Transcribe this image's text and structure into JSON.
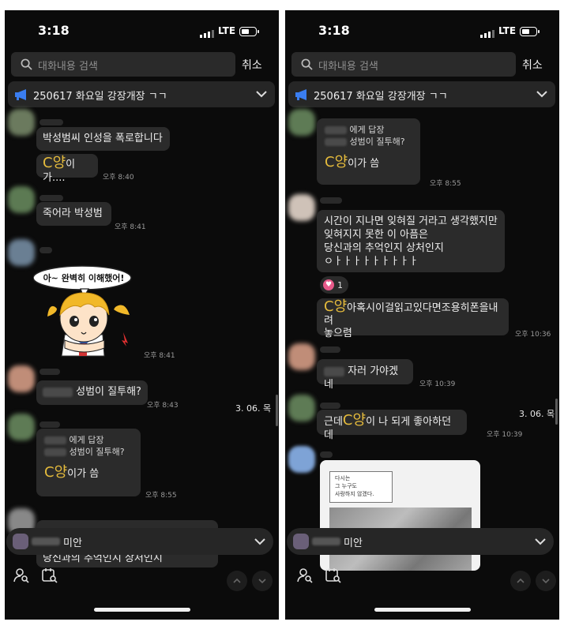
{
  "colors": {
    "accent_yellow": "#e5bb3c",
    "bubble": "#2b2b2b",
    "background": "#0b0b0b",
    "notice_icon": "#3a7df0"
  },
  "screens": [
    {
      "time": "3:18",
      "network": "LTE",
      "search_placeholder": "대화내용 검색",
      "cancel": "취소",
      "notice": "250617 화요일 강장개장 ㄱㄱ",
      "msgs": {
        "m1": "박성범씨 인성을 폭로합니다",
        "m2_y": "C양",
        "m2_rest": "이가....",
        "t2": "오후 8:40",
        "m3": "죽어라 박성범",
        "t3": "오후 8:41",
        "sticker_text": "아~ 완벽히 이해했어!",
        "t4": "오후 8:41",
        "m5": "성범이 질투해?",
        "t5": "오후 8:43",
        "reply_to": "에게 답장",
        "reply_quote": "성범이 질투해?",
        "m6_y": "C양",
        "m6_rest": "이가 씀",
        "t6": "오후 8:55",
        "cut_text": "당신과의 추억인지 상처인지"
      },
      "date_label": "3. 06. 목",
      "preview": "미안"
    },
    {
      "time": "3:18",
      "network": "LTE",
      "search_placeholder": "대화내용 검색",
      "cancel": "취소",
      "notice": "250617 화요일 강장개장 ㄱㄱ",
      "msgs": {
        "reply_to": "에게 답장",
        "reply_quote": "성범이 질투해?",
        "m1_y": "C양",
        "m1_rest": "이가 씀",
        "t1": "오후 8:55",
        "m2_l1": "시간이 지나면 잊혀질 거라고 생각했지만",
        "m2_l2": "잊혀지지 못한 이 아픔은",
        "m2_l3": "당신과의 추억인지 상처인지",
        "m2_l4": "ㅇㅏㅏㅏㅏㅏㅏㅏㅏㅏ",
        "reaction_count": "1",
        "m3_y": "C양",
        "m3_l1": "아혹시이걸읽고있다면조용히폰을내려",
        "m3_l2": "놓으렴",
        "t3": "오후 10:36",
        "m4": "자러 가야겠네",
        "t4": "오후 10:39",
        "m5_pre": "근데",
        "m5_y": "C양",
        "m5_post": "이 나 되게 좋아하던데",
        "t5": "오후 10:39",
        "manhwa_l1": "다시는",
        "manhwa_l2": "그 누구도",
        "manhwa_l3": "사랑하지 않겠다."
      },
      "date_label": "3. 06. 목",
      "preview": "미안"
    }
  ]
}
